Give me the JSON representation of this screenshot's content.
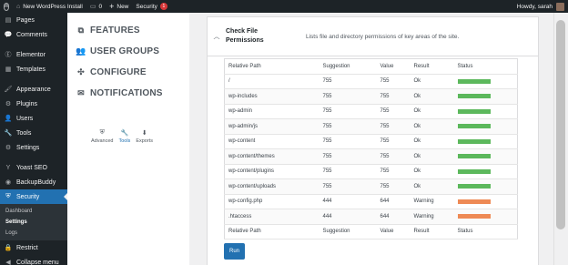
{
  "adminbar": {
    "site_name": "New WordPress Install",
    "comments_count": "0",
    "new_label": "New",
    "security_label": "Security",
    "security_badge": "1",
    "greeting": "Howdy, sarah"
  },
  "sidebar": {
    "items": [
      {
        "label": "Pages",
        "icon": "pages-icon",
        "glyph": "▤"
      },
      {
        "label": "Comments",
        "icon": "comments-icon",
        "glyph": "💬"
      },
      {
        "label": "Elementor",
        "icon": "elementor-icon",
        "glyph": "Ⓔ"
      },
      {
        "label": "Templates",
        "icon": "templates-icon",
        "glyph": "▦"
      },
      {
        "label": "Appearance",
        "icon": "appearance-icon",
        "glyph": "🖌"
      },
      {
        "label": "Plugins",
        "icon": "plugins-icon",
        "glyph": "⚙"
      },
      {
        "label": "Users",
        "icon": "users-icon",
        "glyph": "👤"
      },
      {
        "label": "Tools",
        "icon": "tools-icon",
        "glyph": "🔧"
      },
      {
        "label": "Settings",
        "icon": "settings-icon",
        "glyph": "⚙"
      },
      {
        "label": "Yoast SEO",
        "icon": "yoast-icon",
        "glyph": "Y"
      },
      {
        "label": "BackupBuddy",
        "icon": "backupbuddy-icon",
        "glyph": "◉"
      },
      {
        "label": "Security",
        "icon": "shield-icon",
        "glyph": "⛨"
      }
    ],
    "submenu": [
      "Dashboard",
      "Settings",
      "Logs"
    ],
    "restrict": "Restrict",
    "collapse": "Collapse menu"
  },
  "secnav": {
    "links": [
      {
        "label": "FEATURES",
        "icon": "features-icon",
        "glyph": "⧉"
      },
      {
        "label": "USER GROUPS",
        "icon": "user-groups-icon",
        "glyph": "👥"
      },
      {
        "label": "CONFIGURE",
        "icon": "configure-icon",
        "glyph": "✣"
      },
      {
        "label": "NOTIFICATIONS",
        "icon": "notifications-icon",
        "glyph": "✉"
      }
    ],
    "tools": [
      {
        "label": "Advanced",
        "glyph": "⛨"
      },
      {
        "label": "Tools",
        "glyph": "🔧"
      },
      {
        "label": "Exports",
        "glyph": "⬇"
      }
    ]
  },
  "card": {
    "title_line1": "Check File",
    "title_line2": "Permissions",
    "description": "Lists file and directory permissions of key areas of the site."
  },
  "table": {
    "headers": [
      "Relative Path",
      "Suggestion",
      "Value",
      "Result",
      "Status"
    ],
    "rows": [
      {
        "path": "/",
        "suggestion": "755",
        "value": "755",
        "result": "Ok",
        "status": "ok"
      },
      {
        "path": "wp-includes",
        "suggestion": "755",
        "value": "755",
        "result": "Ok",
        "status": "ok"
      },
      {
        "path": "wp-admin",
        "suggestion": "755",
        "value": "755",
        "result": "Ok",
        "status": "ok"
      },
      {
        "path": "wp-admin/js",
        "suggestion": "755",
        "value": "755",
        "result": "Ok",
        "status": "ok"
      },
      {
        "path": "wp-content",
        "suggestion": "755",
        "value": "755",
        "result": "Ok",
        "status": "ok"
      },
      {
        "path": "wp-content/themes",
        "suggestion": "755",
        "value": "755",
        "result": "Ok",
        "status": "ok"
      },
      {
        "path": "wp-content/plugins",
        "suggestion": "755",
        "value": "755",
        "result": "Ok",
        "status": "ok"
      },
      {
        "path": "wp-content/uploads",
        "suggestion": "755",
        "value": "755",
        "result": "Ok",
        "status": "ok"
      },
      {
        "path": "wp-config.php",
        "suggestion": "444",
        "value": "644",
        "result": "Warning",
        "status": "warning"
      },
      {
        "path": ".htaccess",
        "suggestion": "444",
        "value": "644",
        "result": "Warning",
        "status": "warning"
      }
    ]
  },
  "run_label": "Run",
  "colors": {
    "ok": "#5cb85c",
    "warning": "#ee8a55",
    "accent": "#2271b1"
  }
}
